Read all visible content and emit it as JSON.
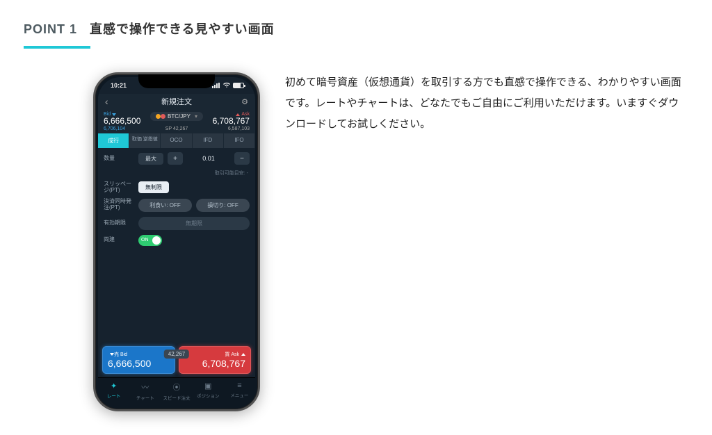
{
  "point": {
    "label": "POINT",
    "num": "1",
    "title": "直感で操作できる見やすい画面"
  },
  "description": "初めて暗号資産（仮想通貨）を取引する方でも直感で操作できる、わかりやすい画面です。レートやチャートは、どなたでもご自由にご利用いただけます。いますぐダウンロードしてお試しください。",
  "phone": {
    "status": {
      "time": "10:21"
    },
    "nav": {
      "back": "‹",
      "title": "新規注文",
      "gear": "⚙"
    },
    "rate": {
      "bid_label": "Bid",
      "bid_value": "6,666,500",
      "bid_sub": "6,706,104",
      "ask_label": "Ask",
      "ask_value": "6,708,767",
      "ask_sub": "6,587,103",
      "pair": "BTC/JPY",
      "sp_label": "SP",
      "sp_value": "42,267"
    },
    "tabs": [
      "成行",
      "取価\n逆指値",
      "OCO",
      "IFD",
      "IFO"
    ],
    "form": {
      "qty_label": "数量",
      "qty_max": "最大",
      "qty_value": "0.01",
      "qty_hint": "取引可能目安: -",
      "slip_label": "スリッページ(PT)",
      "slip_value": "無制限",
      "settle_label": "決済同時発注(PT)",
      "take": "利食い: OFF",
      "stop": "損切り: OFF",
      "expire_label": "有効期限",
      "expire_value": "無期限",
      "hedge_label": "両建",
      "hedge_on": "ON"
    },
    "bigbuttons": {
      "sell_label": "売 Bid",
      "sell_price": "6,666,500",
      "buy_label": "買 Ask",
      "buy_price": "6,708,767",
      "spread": "42,267"
    },
    "bottom": [
      {
        "icon": "✦",
        "label": "レート"
      },
      {
        "icon": "〰",
        "label": "チャート"
      },
      {
        "icon": "⦿",
        "label": "スピード注文"
      },
      {
        "icon": "▣",
        "label": "ポジション"
      },
      {
        "icon": "≡",
        "label": "メニュー"
      }
    ]
  }
}
